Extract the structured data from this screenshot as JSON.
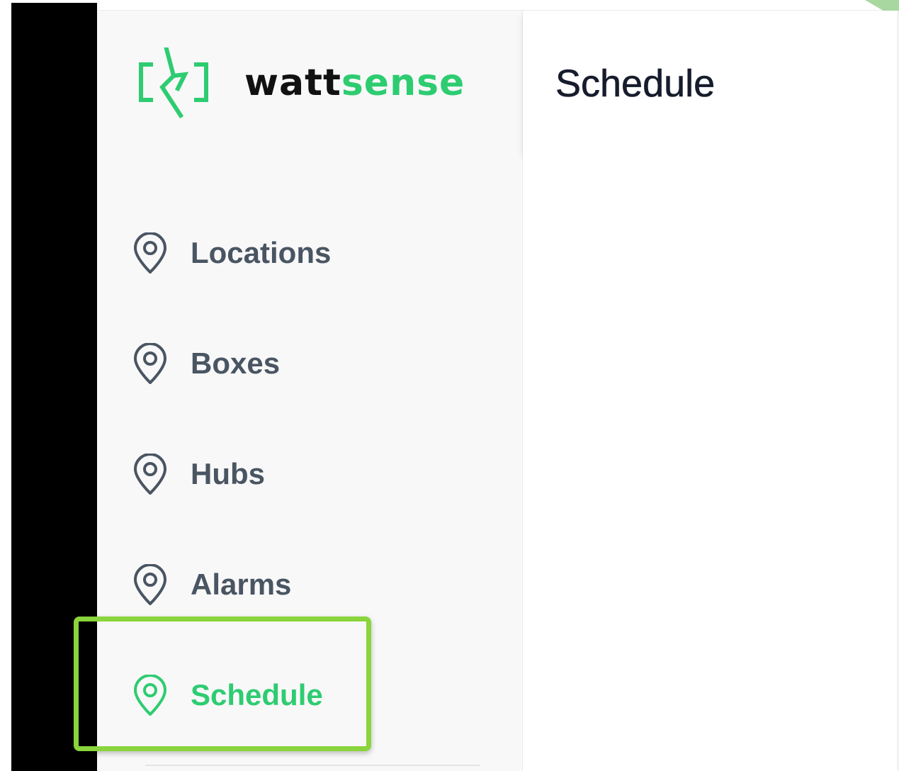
{
  "brand": {
    "name_part1": "watt",
    "name_part2": "sense",
    "accent_color": "#2ecc71",
    "text_color": "#111111",
    "logo_icon": "bracket-bolt-logo"
  },
  "header": {
    "title": "Schedule"
  },
  "sidebar": {
    "items": [
      {
        "label": "Locations",
        "icon": "map-pin-icon",
        "active": false
      },
      {
        "label": "Boxes",
        "icon": "map-pin-icon",
        "active": false
      },
      {
        "label": "Hubs",
        "icon": "map-pin-icon",
        "active": false
      },
      {
        "label": "Alarms",
        "icon": "map-pin-icon",
        "active": false
      },
      {
        "label": "Schedule",
        "icon": "map-pin-icon",
        "active": true
      }
    ],
    "inactive_color": "#4a5563",
    "highlight_color": "#8ad43c"
  }
}
